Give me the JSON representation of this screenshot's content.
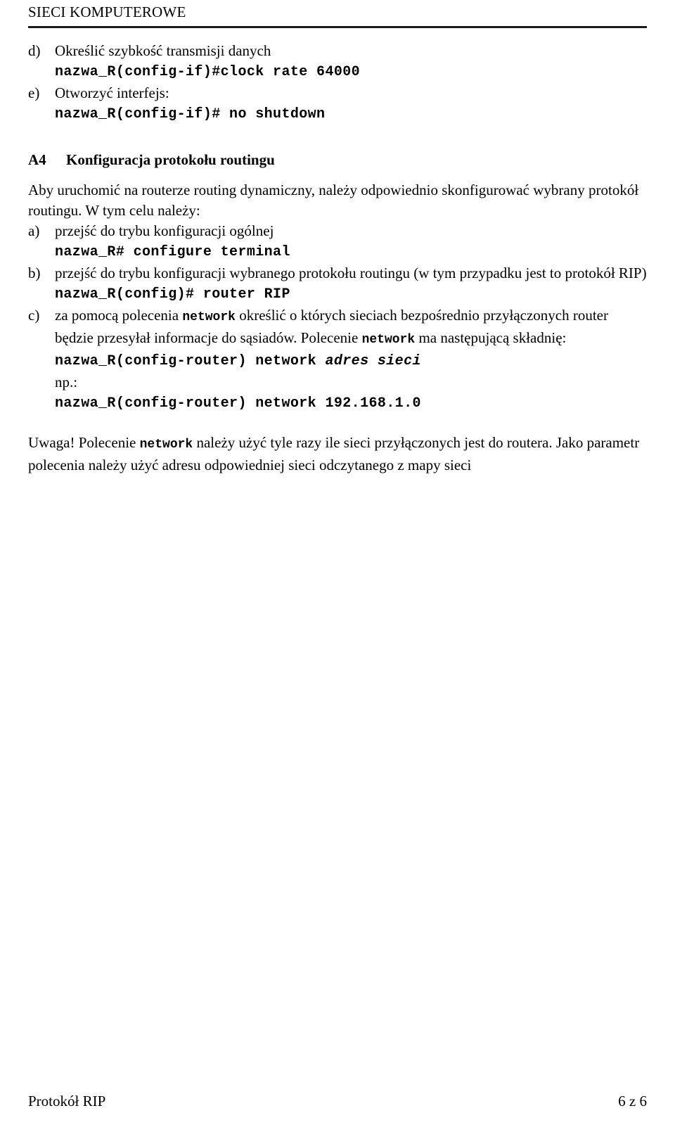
{
  "header": {
    "title": "SIECI KOMPUTEROWE"
  },
  "list_upper": {
    "items": [
      {
        "marker": "d)",
        "text": "Określić szybkość transmisji danych",
        "command": "nazwa_R(config-if)#clock rate 64000"
      },
      {
        "marker": "e)",
        "text": "Otworzyć interfejs:",
        "command": "nazwa_R(config-if)# no shutdown"
      }
    ]
  },
  "section": {
    "number": "A4",
    "title": "Konfiguracja protokołu routingu",
    "intro": "Aby uruchomić na routerze routing dynamiczny, należy odpowiednio skonfigurować wybrany protokół routingu. W tym celu należy:"
  },
  "steps": {
    "a": {
      "marker": "a)",
      "text": "przejść do trybu konfiguracji ogólnej",
      "command": "nazwa_R# configure terminal"
    },
    "b": {
      "marker": "b)",
      "text": "przejść do trybu konfiguracji wybranego protokołu routingu (w tym przypadku jest to protokół RIP)",
      "command": "nazwa_R(config)# router RIP"
    },
    "c": {
      "marker": "c)",
      "text_part1": "za pomocą polecenia ",
      "code1": "network",
      "text_part2": " określić o których sieciach bezpośrednio przyłączonych router będzie przesyłał informacje do sąsiadów. Polecenie ",
      "code2": "network",
      "text_part3": " ma następującą składnię:",
      "syntax_prefix": "nazwa_R(config-router) network ",
      "syntax_param": "adres sieci",
      "example_label": "np.:",
      "example_command": "nazwa_R(config-router) network 192.168.1.0"
    }
  },
  "note": {
    "part1": "Uwaga! Polecenie ",
    "code": "network",
    "part2": " należy użyć tyle razy ile sieci przyłączonych jest do routera. Jako parametr polecenia należy użyć adresu odpowiedniej sieci odczytanego z mapy sieci"
  },
  "footer": {
    "left": "Protokół RIP",
    "right": "6 z 6"
  }
}
